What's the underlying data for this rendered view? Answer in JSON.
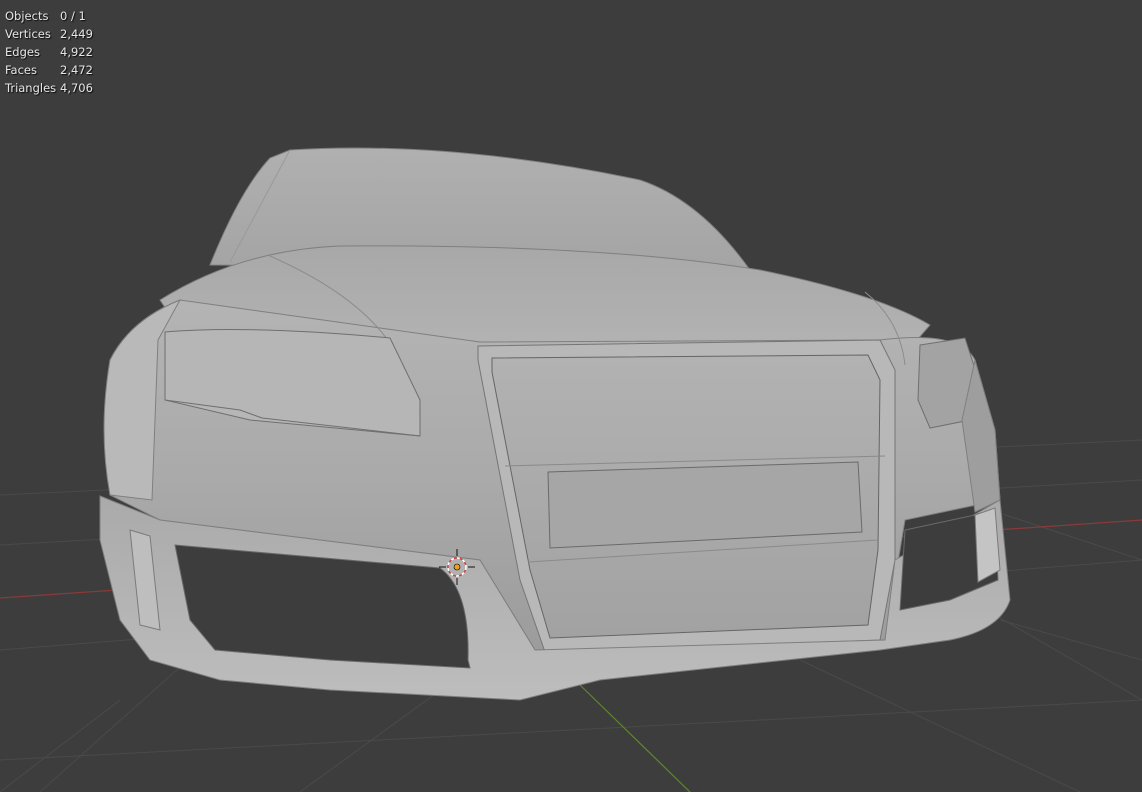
{
  "viewport": {
    "background": "#3d3d3d",
    "grid_color": "#4a4a4a",
    "x_axis_color": "#8a3a3a",
    "y_axis_color": "#5a8a2a",
    "model_color": "#b5b5b5",
    "cursor_icon": "3d-cursor-icon",
    "origin_icon": "object-origin-dot-icon"
  },
  "stats": {
    "rows": [
      {
        "label": "Objects",
        "value": "0 / 1"
      },
      {
        "label": "Vertices",
        "value": "2,449"
      },
      {
        "label": "Edges",
        "value": "4,922"
      },
      {
        "label": "Faces",
        "value": "2,472"
      },
      {
        "label": "Triangles",
        "value": "4,706"
      }
    ]
  }
}
